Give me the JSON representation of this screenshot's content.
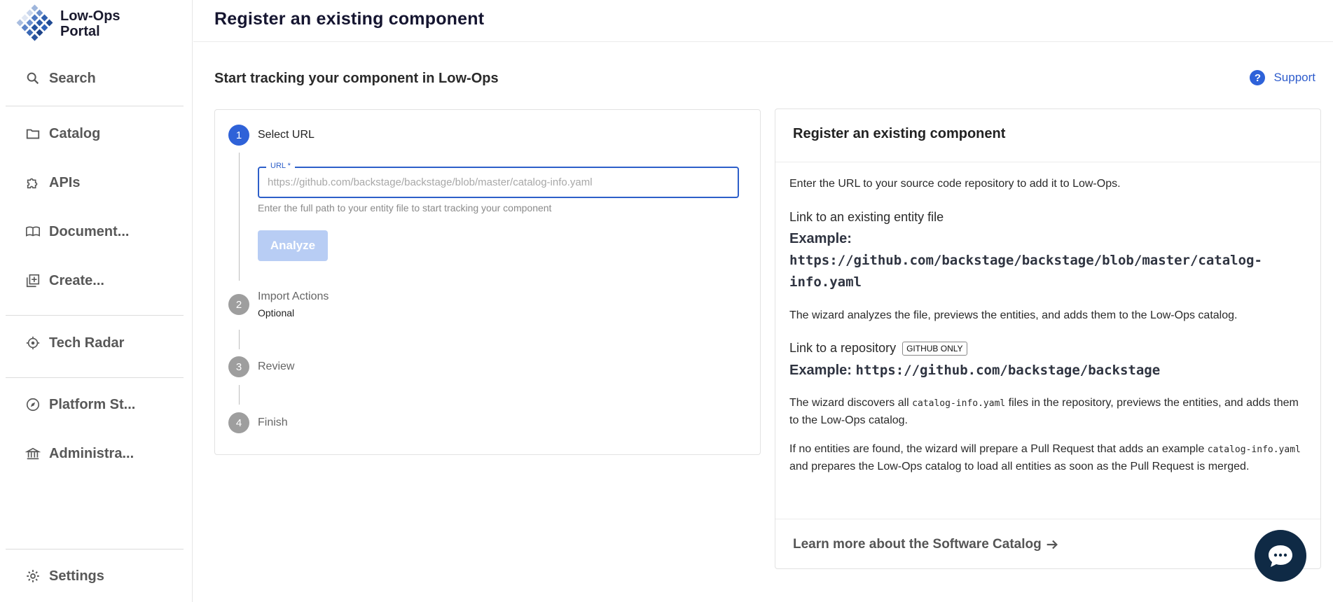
{
  "sidebar": {
    "logo_line1": "Low-Ops",
    "logo_line2": "Portal",
    "items": [
      {
        "label": "Search",
        "icon": "search-icon"
      },
      {
        "label": "Catalog",
        "icon": "folder-icon"
      },
      {
        "label": "APIs",
        "icon": "puzzle-icon"
      },
      {
        "label": "Document...",
        "icon": "book-icon"
      },
      {
        "label": "Create...",
        "icon": "create-icon"
      },
      {
        "label": "Tech Radar",
        "icon": "radar-icon"
      },
      {
        "label": "Platform St...",
        "icon": "compass-icon"
      },
      {
        "label": "Administra...",
        "icon": "bank-icon"
      },
      {
        "label": "Settings",
        "icon": "gear-icon"
      }
    ]
  },
  "header": {
    "title": "Register an existing component"
  },
  "main": {
    "subtitle": "Start tracking your component in Low-Ops",
    "support_label": "Support",
    "stepper": {
      "steps": [
        {
          "number": "1",
          "label": "Select URL"
        },
        {
          "number": "2",
          "label": "Import Actions",
          "optional": "Optional"
        },
        {
          "number": "3",
          "label": "Review"
        },
        {
          "number": "4",
          "label": "Finish"
        }
      ],
      "url_label": "URL *",
      "url_value": "",
      "url_placeholder": "https://github.com/backstage/backstage/blob/master/catalog-info.yaml",
      "helper_text": "Enter the full path to your entity file to start tracking your component",
      "analyze_label": "Analyze"
    },
    "info": {
      "title": "Register an existing component",
      "intro": "Enter the URL to your source code repository to add it to Low-Ops.",
      "link_file_heading": "Link to an existing entity file",
      "example_label": "Example:",
      "example_file_url_line1": "https://github.com/backstage/backstage/blob/master/catalog-",
      "example_file_url_line2": "info.yaml",
      "file_text": "The wizard analyzes the file, previews the entities, and adds them to the Low-Ops catalog.",
      "link_repo_heading": "Link to a repository",
      "github_badge": "GITHUB ONLY",
      "example_repo_url": "https://github.com/backstage/backstage",
      "repo_text_pre": "The wizard discovers all ",
      "repo_text_code": "catalog-info.yaml",
      "repo_text_post": " files in the repository, previews the entities, and adds them to the Low-Ops catalog.",
      "pr_text_pre": "If no entities are found, the wizard will prepare a Pull Request that adds an example ",
      "pr_text_code": "catalog-info.yaml",
      "pr_text_post": " and prepares the Low-Ops catalog to load all entities as soon as the Pull Request is merged.",
      "learn_more": "Learn more about the Software Catalog"
    }
  },
  "colors": {
    "accent": "#2f62d8",
    "chat_button": "#0f2a45",
    "analyze_disabled": "#b8cdf4"
  }
}
